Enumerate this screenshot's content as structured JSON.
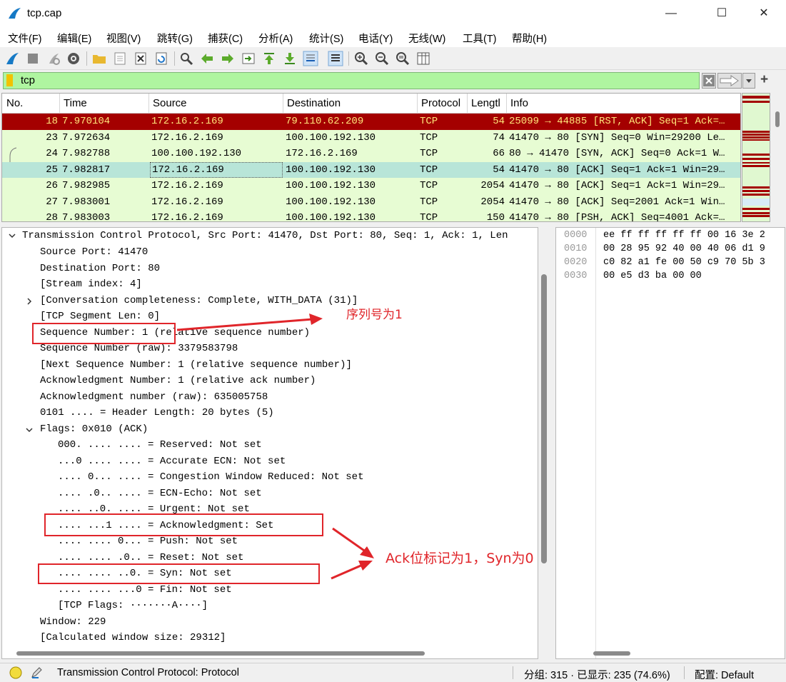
{
  "window": {
    "title": "tcp.cap",
    "minimize": "—",
    "maximize": "☐",
    "close": "✕"
  },
  "menu": [
    "文件(F)",
    "编辑(E)",
    "视图(V)",
    "跳转(G)",
    "捕获(C)",
    "分析(A)",
    "统计(S)",
    "电话(Y)",
    "无线(W)",
    "工具(T)",
    "帮助(H)"
  ],
  "filter": {
    "value": "tcp",
    "add_label": "+"
  },
  "packet_list": {
    "headers": [
      "No.",
      "Time",
      "Source",
      "Destination",
      "Protocol",
      "Lengtl",
      "Info"
    ],
    "rows": [
      {
        "no": "18",
        "time": "7.970104",
        "src": "172.16.2.169",
        "dst": "79.110.62.209",
        "proto": "TCP",
        "len": "54",
        "info": "25099 → 44885 [RST, ACK] Seq=1 Ack=…"
      },
      {
        "no": "23",
        "time": "7.972634",
        "src": "172.16.2.169",
        "dst": "100.100.192.130",
        "proto": "TCP",
        "len": "74",
        "info": "41470 → 80 [SYN] Seq=0 Win=29200 Le…"
      },
      {
        "no": "24",
        "time": "7.982788",
        "src": "100.100.192.130",
        "dst": "172.16.2.169",
        "proto": "TCP",
        "len": "66",
        "info": "80 → 41470 [SYN, ACK] Seq=0 Ack=1 W…"
      },
      {
        "no": "25",
        "time": "7.982817",
        "src": "172.16.2.169",
        "dst": "100.100.192.130",
        "proto": "TCP",
        "len": "54",
        "info": "41470 → 80 [ACK] Seq=1 Ack=1 Win=29…"
      },
      {
        "no": "26",
        "time": "7.982985",
        "src": "172.16.2.169",
        "dst": "100.100.192.130",
        "proto": "TCP",
        "len": "2054",
        "info": "41470 → 80 [ACK] Seq=1 Ack=1 Win=29…"
      },
      {
        "no": "27",
        "time": "7.983001",
        "src": "172.16.2.169",
        "dst": "100.100.192.130",
        "proto": "TCP",
        "len": "2054",
        "info": "41470 → 80 [ACK] Seq=2001 Ack=1 Win…"
      },
      {
        "no": "28",
        "time": "7.983003",
        "src": "172.16.2.169",
        "dst": "100.100.192.130",
        "proto": "TCP",
        "len": "150",
        "info": "41470 → 80 [PSH, ACK] Seq=4001 Ack=…"
      }
    ]
  },
  "details": [
    "Transmission Control Protocol, Src Port: 41470, Dst Port: 80, Seq: 1, Ack: 1, Len",
    "Source Port: 41470",
    "Destination Port: 80",
    "[Stream index: 4]",
    "[Conversation completeness: Complete, WITH_DATA (31)]",
    "[TCP Segment Len: 0]",
    "Sequence Number: 1    (relative sequence number)",
    "Sequence Number (raw): 3379583798",
    "[Next Sequence Number: 1    (relative sequence number)]",
    "Acknowledgment Number: 1    (relative ack number)",
    "Acknowledgment number (raw): 635005758",
    "0101 .... = Header Length: 20 bytes (5)",
    "Flags: 0x010 (ACK)",
    "000. .... .... = Reserved: Not set",
    "...0 .... .... = Accurate ECN: Not set",
    ".... 0... .... = Congestion Window Reduced: Not set",
    ".... .0.. .... = ECN-Echo: Not set",
    ".... ..0. .... = Urgent: Not set",
    ".... ...1 .... = Acknowledgment: Set",
    ".... .... 0... = Push: Not set",
    ".... .... .0.. = Reset: Not set",
    ".... .... ..0. = Syn: Not set",
    ".... .... ...0 = Fin: Not set",
    "[TCP Flags: ·······A····]",
    "Window: 229",
    "[Calculated window size: 29312]"
  ],
  "hex": [
    {
      "offset": "0000",
      "bytes": "ee ff ff ff ff ff 00 16  3e 2"
    },
    {
      "offset": "0010",
      "bytes": "00 28 95 92 40 00 40 06  d1 9"
    },
    {
      "offset": "0020",
      "bytes": "c0 82 a1 fe 00 50 c9 70  5b 3"
    },
    {
      "offset": "0030",
      "bytes": "00 e5 d3 ba 00 00"
    }
  ],
  "annotations": {
    "seq_note": "序列号为1",
    "flags_note": "Ack位标记为1，Syn为0"
  },
  "status": {
    "field": "Transmission Control Protocol: Protocol",
    "packets": "分组: 315 · 已显示: 235 (74.6%)",
    "profile": "配置: Default"
  },
  "colors": {
    "rst_row_bg": "#a40000",
    "tcp_row_bg": "#e7fcd3",
    "selected_bg": "#b8e5d8",
    "filter_bg": "#aff5a0",
    "annotation": "#e0252a"
  }
}
